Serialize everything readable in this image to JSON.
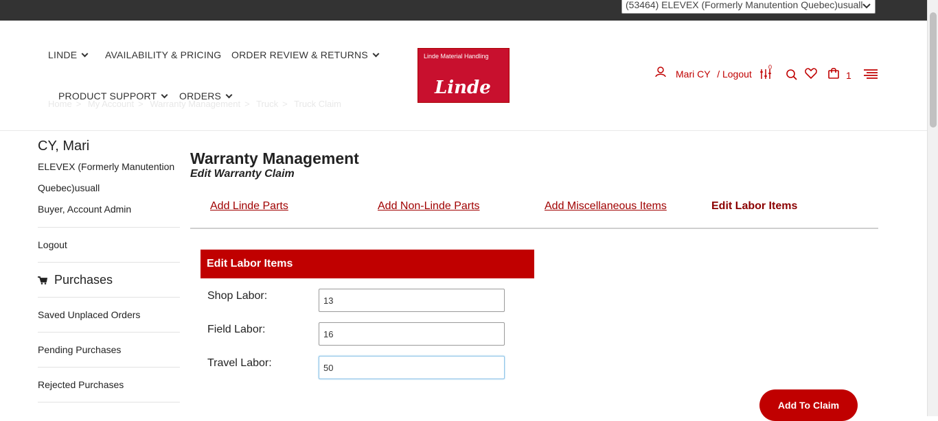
{
  "topbar": {
    "account_select": "(53464) ELEVEX (Formerly Manutention Quebec)usuall"
  },
  "nav": {
    "linde": "LINDE",
    "availability": "AVAILABILITY & PRICING",
    "order_review": "ORDER REVIEW & RETURNS",
    "product_support": "PRODUCT SUPPORT",
    "orders": "ORDERS"
  },
  "breadcrumb": [
    "Home",
    "My Account",
    "Warranty Management",
    "Truck",
    "Truck Claim"
  ],
  "logo": {
    "tagline": "Linde Material Handling",
    "brand": "Linde"
  },
  "header_right": {
    "user_name": "Mari CY",
    "logout": "/ Logout",
    "compare_count": "0",
    "cart_count": "1",
    "icons": [
      "user-icon",
      "compare-icon",
      "search-icon",
      "heart-icon",
      "cart-icon",
      "menu-icon"
    ]
  },
  "sidebar": {
    "name": "CY, Mari",
    "company_line1": "ELEVEX (Formerly Manutention",
    "company_line2": "Quebec)usuall",
    "role": "Buyer, Account Admin",
    "logout": "Logout",
    "purchases_heading": "Purchases",
    "items": [
      "Saved Unplaced Orders",
      "Pending Purchases",
      "Rejected Purchases"
    ]
  },
  "main": {
    "title": "Warranty Management",
    "subtitle": "Edit Warranty Claim",
    "tabs": [
      "Add Linde Parts",
      "Add Non-Linde Parts",
      "Add Miscellaneous Items",
      "Edit Labor Items"
    ],
    "active_tab": "Edit Labor Items"
  },
  "form": {
    "heading": "Edit Labor Items",
    "shop_label": "Shop Labor:",
    "shop_value": "13",
    "field_label": "Field Labor:",
    "field_value": "16",
    "travel_label": "Travel Labor:",
    "travel_value": "50",
    "submit": "Add To Claim"
  },
  "colors": {
    "brand_red": "#c00000",
    "topbar": "#333333"
  }
}
